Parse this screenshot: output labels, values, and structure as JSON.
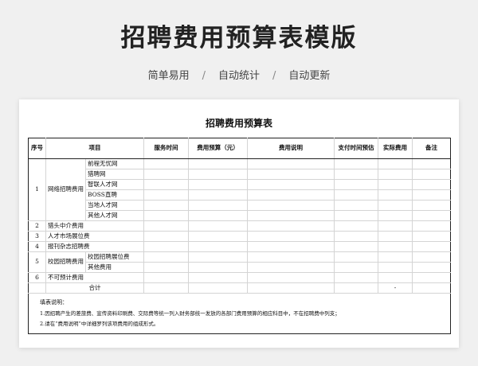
{
  "header": {
    "title": "招聘费用预算表模版",
    "features": [
      "简单易用",
      "自动统计",
      "自动更新"
    ],
    "separator": "/"
  },
  "sheet": {
    "title": "招聘费用预算表",
    "columns": [
      "序号",
      "项目",
      "服务时间",
      "费用预算（元）",
      "费用说明",
      "支付时间预估",
      "实际费用",
      "备注"
    ],
    "groups": {
      "g1": {
        "no": "1",
        "name": "网络招聘费用",
        "items": [
          "前程无忧网",
          "猎聘网",
          "智联人才网",
          "BOSS直聘",
          "当地人才网",
          "其他人才网"
        ]
      },
      "g2": {
        "no": "2",
        "name": "猎头中介费用"
      },
      "g3": {
        "no": "3",
        "name": "人才市场展位费"
      },
      "g4": {
        "no": "4",
        "name": "报刊杂志招聘费"
      },
      "g5": {
        "no": "5",
        "name": "校园招聘费用",
        "items": [
          "校园招聘展位费",
          "其他费用"
        ]
      },
      "g6": {
        "no": "6",
        "name": "不可预计费用"
      }
    },
    "total": {
      "label": "合计",
      "actual": "-"
    },
    "notes": {
      "title": "填表说明：",
      "lines": [
        "1.因招聘产生的差旅费、宣传资料印刷费、交际费等统一列入财务部统一发放的各部门费用预算的相应科目中，不在招聘费中列支；",
        "2.请在“费用说明”中详细罗列该项费用的组成形式。"
      ]
    }
  }
}
